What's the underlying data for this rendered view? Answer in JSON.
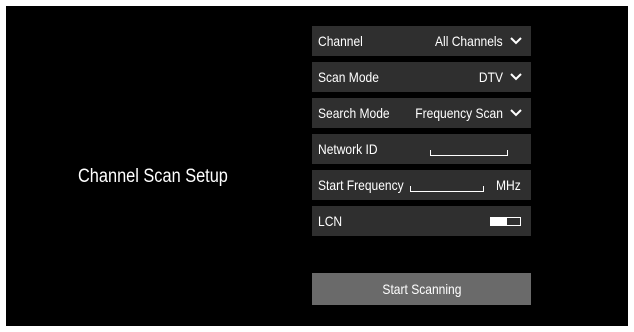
{
  "title": "Channel Scan Setup",
  "rows": [
    {
      "label": "Channel",
      "value": "All Channels"
    },
    {
      "label": "Scan Mode",
      "value": "DTV"
    },
    {
      "label": "Search Mode",
      "value": "Frequency Scan"
    },
    {
      "label": "Network ID",
      "value": ""
    },
    {
      "label": "Start Frequency",
      "value": "",
      "unit": "MHz"
    },
    {
      "label": "LCN",
      "toggle_on": true
    }
  ],
  "start_button": "Start Scanning",
  "colors": {
    "background": "#000000",
    "row_bg": "#2f2f2f",
    "button_bg": "#6a6a6a",
    "text": "#ffffff"
  },
  "icons": {
    "dropdown": "chevron-down-icon",
    "toggle": "toggle-switch"
  }
}
